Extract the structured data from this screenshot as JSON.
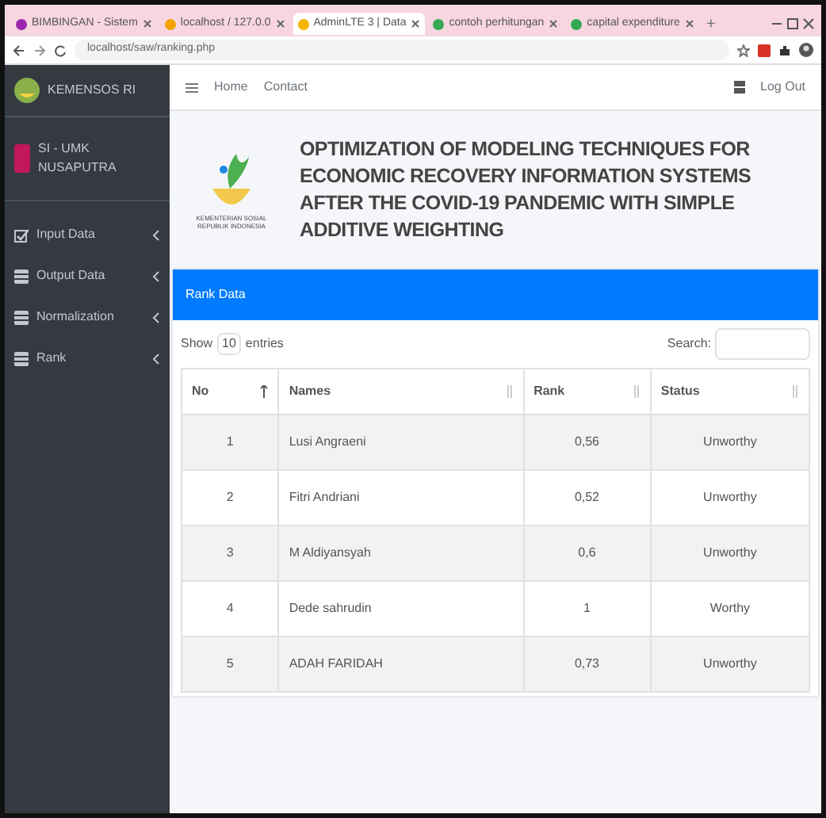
{
  "browser": {
    "tabs": [
      {
        "title": "BIMBINGAN - Sistem",
        "selected": false,
        "color": "#9c27b0"
      },
      {
        "title": "localhost / 127.0.0",
        "selected": false,
        "color": "#f4a300"
      },
      {
        "title": "AdminLTE 3 | Data",
        "selected": true,
        "color": "#f4b400"
      },
      {
        "title": "contoh perhitungan",
        "selected": false,
        "color": "#34a853"
      },
      {
        "title": "capital expenditure",
        "selected": false,
        "color": "#34a853"
      }
    ],
    "new_tab": "+",
    "address": "localhost/saw/ranking.php"
  },
  "sidebar": {
    "brand": "KEMENSOS RI",
    "user": "SI - UMK NUSAPUTRA",
    "items": [
      {
        "label": "Input Data",
        "kind": "check"
      },
      {
        "label": "Output Data",
        "kind": "table"
      },
      {
        "label": "Normalization",
        "kind": "table"
      },
      {
        "label": "Rank",
        "kind": "table"
      }
    ]
  },
  "navbar": {
    "links": [
      "Home",
      "Contact"
    ],
    "logout": "Log Out"
  },
  "header": {
    "logo_caption": "KEMENTERIAN SOSIAL REPUBLIK INDONESIA",
    "title": "OPTIMIZATION OF MODELING TECHNIQUES FOR ECONOMIC RECOVERY INFORMATION SYSTEMS AFTER THE COVID-19 PANDEMIC WITH SIMPLE ADDITIVE WEIGHTING"
  },
  "card": {
    "title": "Rank Data",
    "show_label": "Show",
    "entries_value": "10",
    "entries_label": "entries",
    "search_label": "Search:",
    "table": {
      "columns": [
        {
          "label": "No",
          "sorted": true
        },
        {
          "label": "Names",
          "sorted": false
        },
        {
          "label": "Rank",
          "sorted": false
        },
        {
          "label": "Status",
          "sorted": false
        }
      ],
      "rows": [
        [
          "1",
          "Lusi Angraeni",
          "0,56",
          "Unworthy"
        ],
        [
          "2",
          "Fitri Andriani",
          "0,52",
          "Unworthy"
        ],
        [
          "3",
          "M Aldiyansyah",
          "0,6",
          "Unworthy"
        ],
        [
          "4",
          "Dede sahrudin",
          "1",
          "Worthy"
        ],
        [
          "5",
          "ADAH FARIDAH",
          "0,73",
          "Unworthy"
        ]
      ]
    }
  }
}
